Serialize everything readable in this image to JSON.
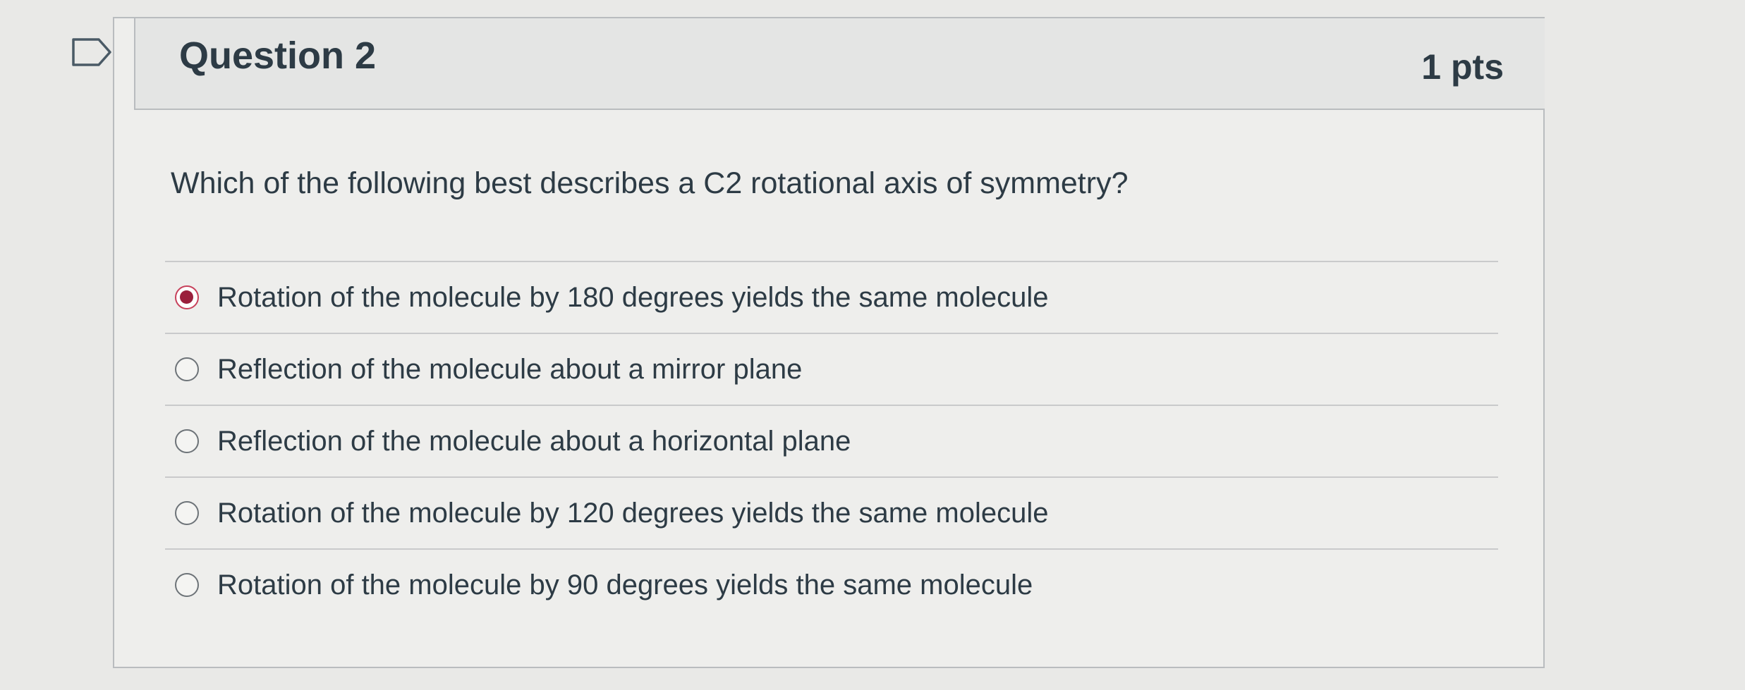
{
  "question": {
    "title": "Question 2",
    "points": "1 pts",
    "text": "Which of the following best describes a C2 rotational axis of symmetry?",
    "flag_icon": "flag-icon"
  },
  "answers": [
    {
      "label": "Rotation of the molecule by 180 degrees yields the same molecule",
      "selected": true
    },
    {
      "label": "Reflection of the molecule about a mirror plane",
      "selected": false
    },
    {
      "label": "Reflection of the molecule about a horizontal plane",
      "selected": false
    },
    {
      "label": "Rotation of the molecule by 120 degrees yields the same molecule",
      "selected": false
    },
    {
      "label": "Rotation of the molecule by 90 degrees yields the same molecule",
      "selected": false
    }
  ],
  "colors": {
    "selected_radio": "#9a1f3c",
    "text": "#2d3b45",
    "background": "#e9e9e7"
  }
}
